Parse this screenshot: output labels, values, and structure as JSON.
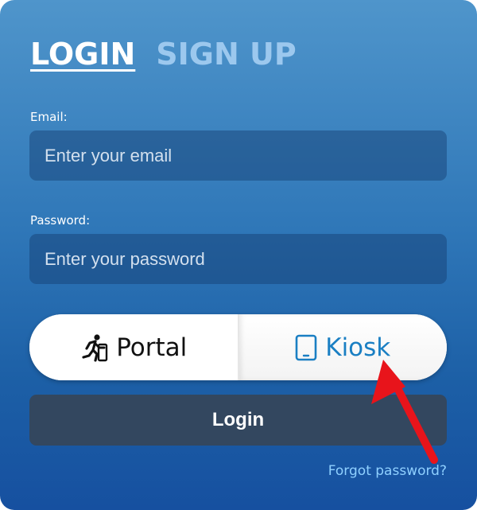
{
  "tabs": {
    "login": "LOGIN",
    "signup": "SIGN UP"
  },
  "email": {
    "label": "Email:",
    "placeholder": "Enter your email"
  },
  "password": {
    "label": "Password:",
    "placeholder": "Enter your password"
  },
  "mode_toggle": {
    "options": [
      {
        "label": "Portal",
        "icon": "running-person-icon",
        "selected": false
      },
      {
        "label": "Kiosk",
        "icon": "tablet-icon",
        "selected": true
      }
    ]
  },
  "login_button": {
    "label": "Login"
  },
  "forgot_password": {
    "label": "Forgot password?"
  },
  "annotation": {
    "icon": "red-arrow-pointing-at-kiosk",
    "color": "#e8141b"
  },
  "colors": {
    "card_top": "#4f95cb",
    "card_bottom": "#1650a0",
    "login_button": "#33475f",
    "kiosk_accent": "#1a7fc3",
    "link": "#8fd0ff"
  }
}
